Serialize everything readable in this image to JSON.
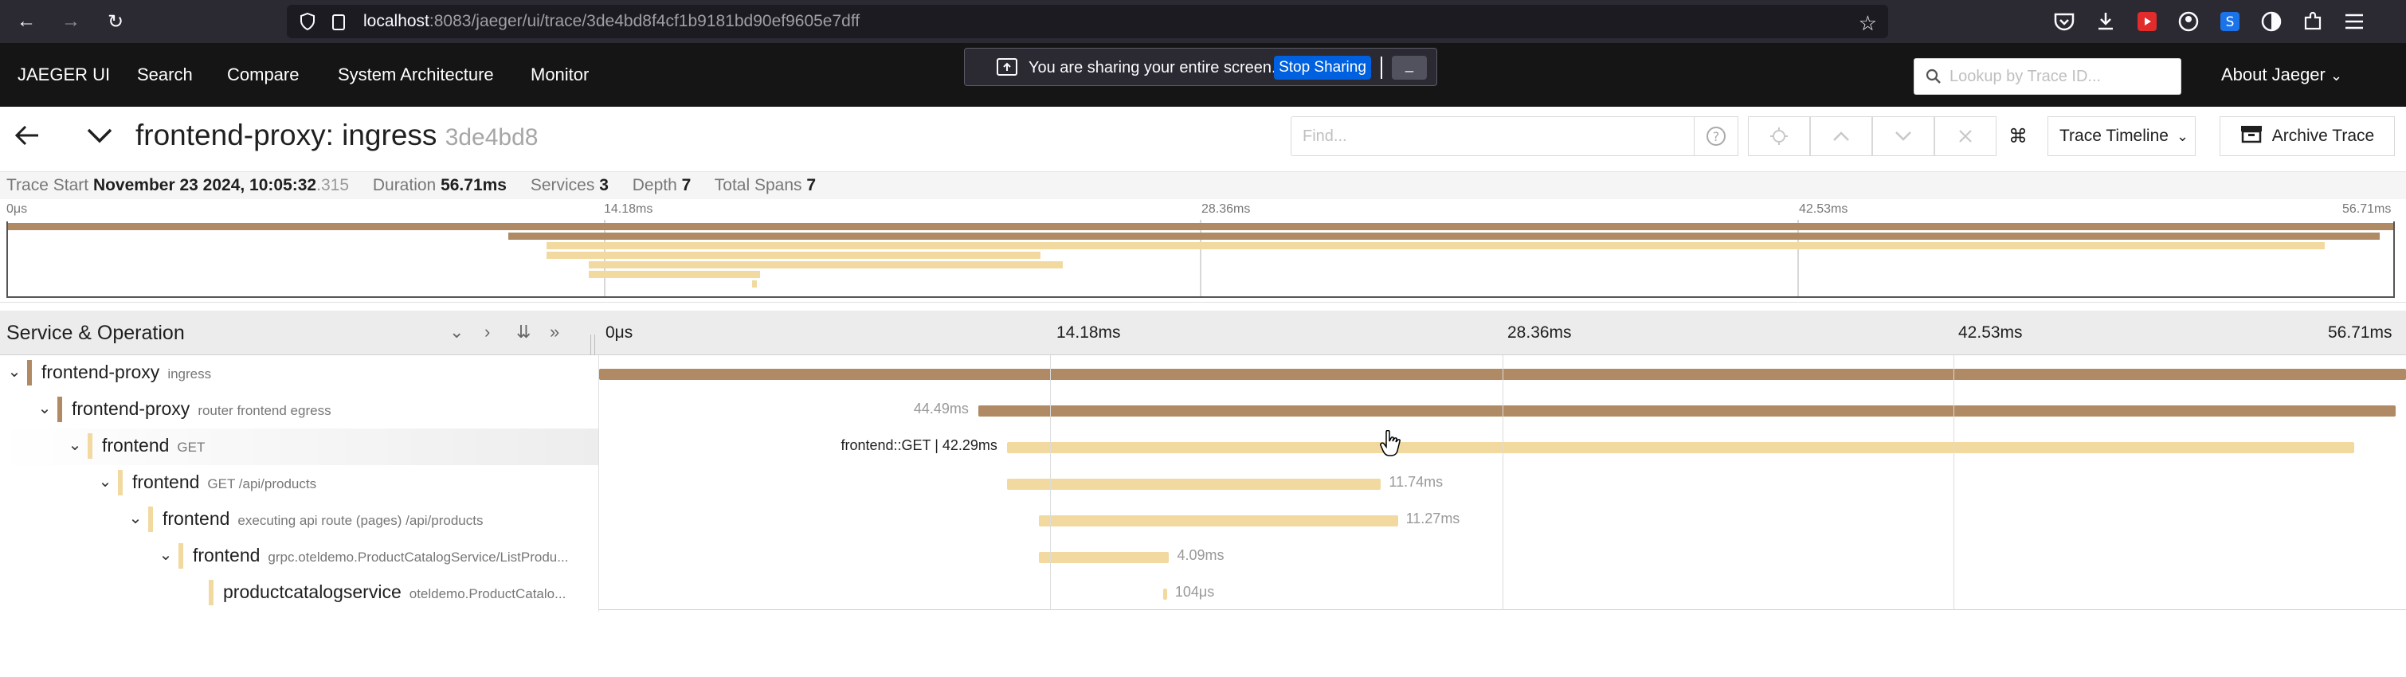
{
  "browser": {
    "url_host": "localhost",
    "url_rest": ":8083/jaeger/ui/trace/3de4bd8f4cf1b9181bd90ef9605e7dff"
  },
  "sharing": {
    "message": "You are sharing your entire screen.",
    "stop_label": "Stop Sharing",
    "hide_label": "_"
  },
  "topnav": {
    "brand": "JAEGER UI",
    "items": [
      "Search",
      "Compare",
      "System Architecture",
      "Monitor"
    ],
    "lookup_placeholder": "Lookup by Trace ID...",
    "about": "About Jaeger"
  },
  "trace": {
    "service": "frontend-proxy: ingress",
    "trace_id_short": "3de4bd8",
    "find_placeholder": "Find...",
    "view_select": "Trace Timeline",
    "archive_label": "Archive Trace"
  },
  "meta": {
    "start_label": "Trace Start",
    "start_date": "November 23 2024, 10:05:32",
    "start_ms": ".315",
    "duration_label": "Duration",
    "duration": "56.71ms",
    "services_label": "Services",
    "services": "3",
    "depth_label": "Depth",
    "depth": "7",
    "spans_label": "Total Spans",
    "spans": "7"
  },
  "minimap": {
    "ticks": [
      "0μs",
      "14.18ms",
      "28.36ms",
      "42.53ms",
      "56.71ms"
    ]
  },
  "timeline": {
    "header_title": "Service & Operation",
    "ticks": [
      "0μs",
      "14.18ms",
      "28.36ms",
      "42.53ms",
      "56.71ms"
    ]
  },
  "spans": [
    {
      "service": "frontend-proxy",
      "operation": "ingress",
      "depth": 0,
      "start_ms": 0.0,
      "duration_ms": 56.71,
      "duration_label": "",
      "color": "#b08a64"
    },
    {
      "service": "frontend-proxy",
      "operation": "router frontend egress",
      "depth": 1,
      "start_ms": 11.9,
      "duration_ms": 44.49,
      "duration_label": "44.49ms",
      "color": "#b08a64"
    },
    {
      "service": "frontend",
      "operation": "GET",
      "depth": 2,
      "start_ms": 12.8,
      "duration_ms": 42.29,
      "duration_label": "frontend::GET | 42.29ms",
      "color": "#f2d9a0"
    },
    {
      "service": "frontend",
      "operation": "GET /api/products",
      "depth": 3,
      "start_ms": 12.8,
      "duration_ms": 11.74,
      "duration_label": "11.74ms",
      "color": "#f2d9a0"
    },
    {
      "service": "frontend",
      "operation": "executing api route (pages) /api/products",
      "depth": 4,
      "start_ms": 13.8,
      "duration_ms": 11.27,
      "duration_label": "11.27ms",
      "color": "#f2d9a0"
    },
    {
      "service": "frontend",
      "operation": "grpc.oteldemo.ProductCatalogService/ListProdu...",
      "depth": 5,
      "start_ms": 13.8,
      "duration_ms": 4.09,
      "duration_label": "4.09ms",
      "color": "#f2d9a0"
    },
    {
      "service": "productcatalogservice",
      "operation": "oteldemo.ProductCatalo...",
      "depth": 6,
      "start_ms": 17.7,
      "duration_ms": 0.104,
      "duration_label": "104μs",
      "color": "#f2d9a0"
    }
  ],
  "colors": {
    "proxy": "#b08a64",
    "frontend": "#f2d9a0",
    "productcatalog": "#f2d9a0"
  }
}
